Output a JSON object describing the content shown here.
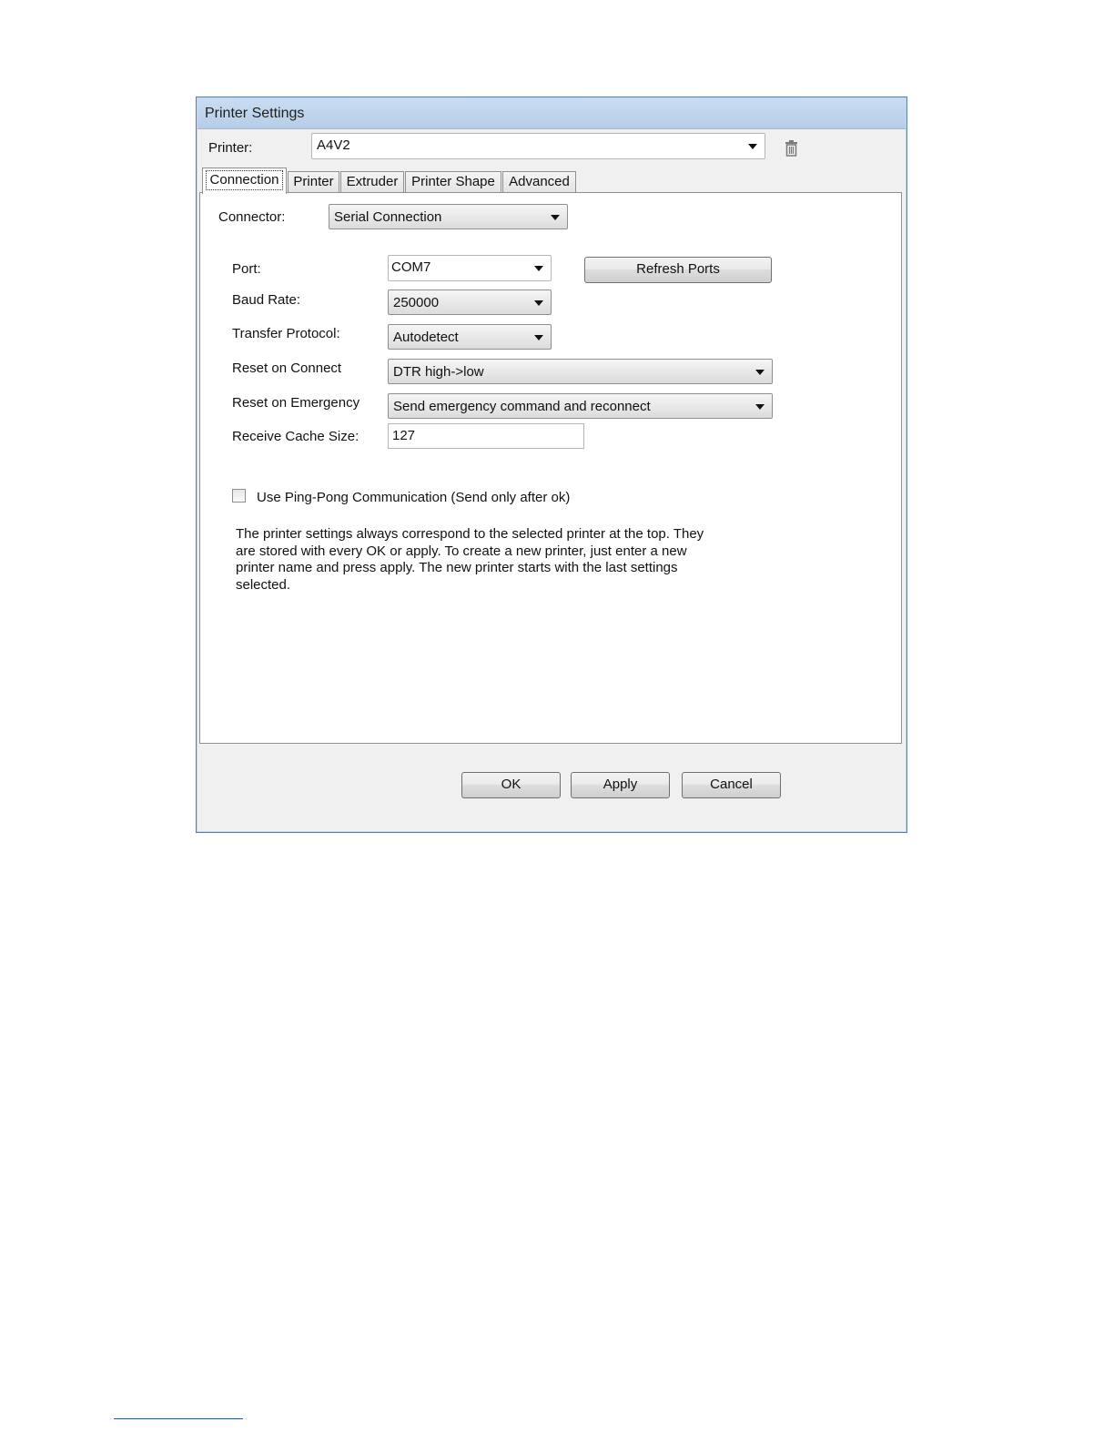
{
  "window": {
    "title": "Printer Settings"
  },
  "printer": {
    "label": "Printer:",
    "value": "A4V2"
  },
  "tabs": [
    {
      "label": "Connection",
      "active": true
    },
    {
      "label": "Printer",
      "active": false
    },
    {
      "label": "Extruder",
      "active": false
    },
    {
      "label": "Printer Shape",
      "active": false
    },
    {
      "label": "Advanced",
      "active": false
    }
  ],
  "connection": {
    "connector": {
      "label": "Connector:",
      "value": "Serial Connection"
    },
    "port": {
      "label": "Port:",
      "value": "COM7"
    },
    "refresh_ports": "Refresh Ports",
    "baud_rate": {
      "label": "Baud Rate:",
      "value": "250000"
    },
    "transfer_protocol": {
      "label": "Transfer Protocol:",
      "value": "Autodetect"
    },
    "reset_on_connect": {
      "label": "Reset on Connect",
      "value": "DTR high->low"
    },
    "reset_on_emergency": {
      "label": "Reset on Emergency",
      "value": "Send emergency command and reconnect"
    },
    "receive_cache_size": {
      "label": "Receive Cache Size:",
      "value": "127"
    },
    "ping_pong": {
      "label": "Use Ping-Pong Communication (Send only after ok)",
      "checked": false
    },
    "info_lines": [
      "The printer settings always correspond to the selected printer at the top. They",
      "are stored with every OK or apply. To create a new printer, just enter a new",
      "printer name and press apply. The new printer starts with the last settings",
      "selected."
    ]
  },
  "buttons": {
    "ok": "OK",
    "apply": "Apply",
    "cancel": "Cancel"
  },
  "icons": {
    "delete_printer": "trash-icon",
    "dropdown": "chevron-down-icon"
  }
}
